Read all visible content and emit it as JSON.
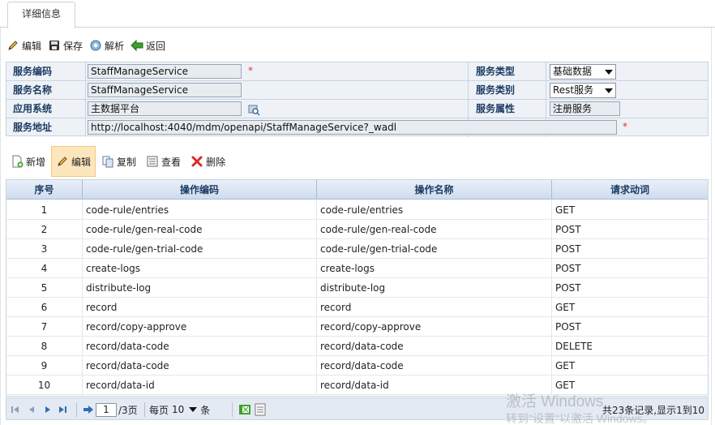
{
  "tab": {
    "label": "详细信息"
  },
  "toolbar": {
    "edit": "编辑",
    "save": "保存",
    "parse": "解析",
    "back": "返回"
  },
  "form": {
    "service_code_label": "服务编码",
    "service_code": "StaffManageService",
    "service_name_label": "服务名称",
    "service_name": "StaffManageService",
    "app_system_label": "应用系统",
    "app_system": "主数据平台",
    "service_url_label": "服务地址",
    "service_url": "http://localhost:4040/mdm/openapi/StaffManageService?_wadl",
    "service_type_label": "服务类型",
    "service_type": "基础数据",
    "service_category_label": "服务类别",
    "service_category": "Rest服务",
    "service_attr_label": "服务属性",
    "service_attr": "注册服务",
    "required_mark": "*"
  },
  "grid_toolbar": {
    "add": "新增",
    "edit": "编辑",
    "copy": "复制",
    "view": "查看",
    "delete": "删除"
  },
  "grid": {
    "headers": [
      "序号",
      "操作编码",
      "操作名称",
      "请求动词"
    ],
    "rows": [
      [
        "1",
        "code-rule/entries",
        "code-rule/entries",
        "GET"
      ],
      [
        "2",
        "code-rule/gen-real-code",
        "code-rule/gen-real-code",
        "POST"
      ],
      [
        "3",
        "code-rule/gen-trial-code",
        "code-rule/gen-trial-code",
        "POST"
      ],
      [
        "4",
        "create-logs",
        "create-logs",
        "POST"
      ],
      [
        "5",
        "distribute-log",
        "distribute-log",
        "POST"
      ],
      [
        "6",
        "record",
        "record",
        "GET"
      ],
      [
        "7",
        "record/copy-approve",
        "record/copy-approve",
        "POST"
      ],
      [
        "8",
        "record/data-code",
        "record/data-code",
        "DELETE"
      ],
      [
        "9",
        "record/data-code",
        "record/data-code",
        "GET"
      ],
      [
        "10",
        "record/data-id",
        "record/data-id",
        "GET"
      ]
    ]
  },
  "pager": {
    "page": "1",
    "total_pages": "/3页",
    "per_page_prefix": "每页",
    "per_page": "10",
    "per_page_suffix": "条",
    "summary": "共23条记录,显示1到10"
  },
  "watermark": {
    "line1": "激活 Windows",
    "line2": "转到\"设置\"以激活 Windows。"
  }
}
